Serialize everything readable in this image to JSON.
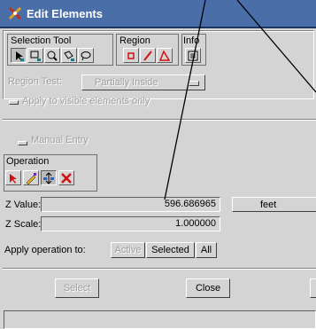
{
  "window": {
    "title": "Edit Elements"
  },
  "selection_tool": {
    "label": "Selection Tool",
    "tools": [
      "pointer-select-icon",
      "rectangle-select-icon",
      "magnifier-select-icon",
      "polygon-select-icon",
      "lasso-select-icon"
    ]
  },
  "region": {
    "label": "Region",
    "tools": [
      "region-rectangle-icon",
      "region-line-icon",
      "region-polygon-icon"
    ]
  },
  "info": {
    "label": "Info",
    "tool": "info-icon"
  },
  "region_test": {
    "label": "Region Test:",
    "value": "Partially Inside"
  },
  "apply_visible": {
    "label": "Apply to visible elements only"
  },
  "manual_entry": {
    "label": "Manual Entry"
  },
  "operation": {
    "label": "Operation",
    "tools": [
      "arrow-icon",
      "pencil-icon",
      "move-z-icon",
      "delete-icon"
    ]
  },
  "z_value": {
    "label": "Z Value:",
    "value": "596.686965",
    "unit": "feet"
  },
  "z_scale": {
    "label": "Z Scale:",
    "value": "1.000000"
  },
  "apply_op": {
    "label": "Apply operation to:",
    "buttons": [
      "Active",
      "Selected",
      "All"
    ]
  },
  "footer": {
    "select": "Select",
    "close": "Close"
  },
  "colors": {
    "title_bar": "#4a6ea8",
    "window": "#d4d4d4",
    "pressed": "#bdbdbd"
  }
}
